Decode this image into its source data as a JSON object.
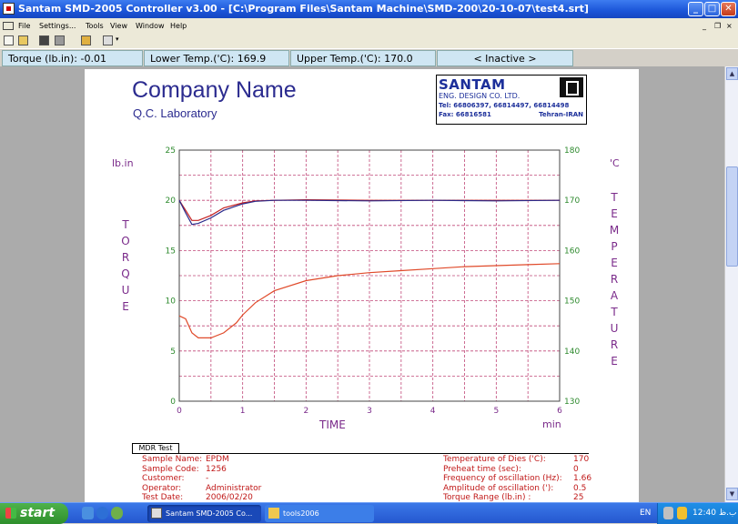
{
  "window": {
    "title": "Santam SMD-2005 Controller v3.00 - [C:\\Program Files\\Santam Machine\\SMD-200\\20-10-07\\test4.srt]"
  },
  "menu": [
    "File",
    "Settings...",
    "Tools",
    "View",
    "Window",
    "Help"
  ],
  "status": {
    "torque": "Torque (lb.in): -0.01",
    "lower": "Lower Temp.('C): 169.9",
    "upper": "Upper Temp.('C): 170.0",
    "state": "< Inactive >"
  },
  "report": {
    "company": "Company Name",
    "lab": "Q.C. Laboratory",
    "logo": {
      "name": "SANTAM",
      "sub": "ENG. DESIGN CO. LTD.",
      "tel": "Tel: 66806397, 66814497, 66814498",
      "fax": "Fax: 66816581",
      "city": "Tehran-IRAN",
      "badge": "SANTAM"
    },
    "section": "MDR Test",
    "left_info": [
      {
        "label": "Sample Name:",
        "value": "EPDM"
      },
      {
        "label": "Sample Code:",
        "value": "1256"
      },
      {
        "label": "Customer:",
        "value": "-"
      },
      {
        "label": "Operator:",
        "value": "Administrator"
      },
      {
        "label": "Test Date:",
        "value": "2006/02/20"
      }
    ],
    "right_info": [
      {
        "label": "Temperature of Dies ('C):",
        "value": "170"
      },
      {
        "label": "Preheat time (sec):",
        "value": "0"
      },
      {
        "label": "Frequency of oscillation (Hz):",
        "value": "1.66"
      },
      {
        "label": "Amplitude of oscillation ('):",
        "value": "0.5"
      },
      {
        "label": "Torque Range (lb.in) :",
        "value": "25"
      }
    ]
  },
  "chart_data": {
    "type": "line",
    "xlabel": "TIME",
    "xunit": "min",
    "ylabel_left": "TORQUE",
    "ylabel_left_unit": "lb.in",
    "ylabel_right": "TEMPERATURE",
    "ylabel_right_unit": "'C",
    "xlim": [
      0,
      6
    ],
    "ylim_left": [
      0,
      25
    ],
    "ylim_right": [
      130,
      180
    ],
    "x_ticks": [
      "0",
      "1",
      "2",
      "3",
      "4",
      "5",
      "6"
    ],
    "y_ticks_left": [
      "0",
      "5",
      "10",
      "15",
      "20",
      "25"
    ],
    "y_ticks_right": [
      "130",
      "140",
      "150",
      "160",
      "170",
      "180"
    ],
    "grid": true,
    "series": [
      {
        "axis": "left",
        "color": "#e04a2a",
        "x": [
          0,
          0.1,
          0.2,
          0.3,
          0.5,
          0.7,
          0.9,
          1.0,
          1.2,
          1.5,
          2.0,
          2.5,
          3.0,
          3.5,
          4.0,
          4.5,
          5.0,
          5.5,
          6.0
        ],
        "y": [
          8.5,
          8.2,
          6.8,
          6.3,
          6.3,
          6.8,
          7.8,
          8.6,
          9.8,
          11.0,
          12.0,
          12.5,
          12.8,
          13.0,
          13.2,
          13.4,
          13.5,
          13.6,
          13.7
        ]
      },
      {
        "axis": "right",
        "color": "#c42020",
        "x": [
          0,
          0.1,
          0.2,
          0.3,
          0.5,
          0.7,
          1.0,
          1.2,
          1.5,
          2.0,
          3.0,
          4.0,
          5.0,
          6.0
        ],
        "y": [
          170,
          168,
          166,
          166,
          167,
          168.5,
          169.5,
          169.9,
          170.0,
          170.1,
          170.0,
          170.0,
          170.0,
          170.0
        ]
      },
      {
        "axis": "right",
        "color": "#2a2a8a",
        "x": [
          0,
          0.1,
          0.2,
          0.3,
          0.5,
          0.7,
          1.0,
          1.2,
          1.5,
          2.0,
          3.0,
          4.0,
          5.0,
          6.0
        ],
        "y": [
          170,
          167.5,
          165.2,
          165.4,
          166.5,
          168,
          169.3,
          169.8,
          170.0,
          170.0,
          169.9,
          170.0,
          169.9,
          170.0
        ]
      }
    ]
  },
  "taskbar": {
    "start": "start",
    "tasks": [
      "Santam SMD-2005 Co...",
      "tools2006"
    ],
    "lang": "EN",
    "clock": "12:40 ب.ظ"
  }
}
